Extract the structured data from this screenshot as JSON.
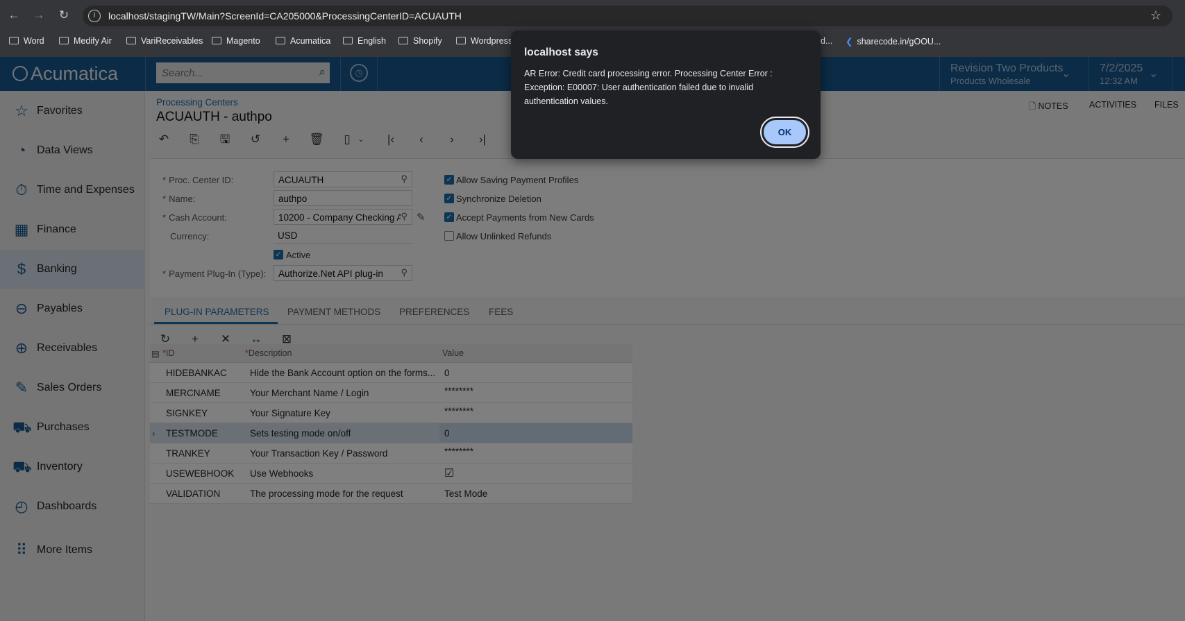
{
  "browser": {
    "url": "localhost/stagingTW/Main?ScreenId=CA205000&ProcessingCenterID=ACUAUTH",
    "bookmarks": [
      "Word",
      "Medify Air",
      "VariReceivables",
      "Magento",
      "Acumatica",
      "English",
      "Shopify",
      "Wordpress",
      "d...",
      "sharecode.in/gOOU..."
    ]
  },
  "header": {
    "logo": "Acumatica",
    "search_placeholder": "Search...",
    "company": "Revision Two Products",
    "branch": "Products Wholesale",
    "date": "7/2/2025",
    "time": "12:32 AM"
  },
  "sidebar": {
    "items": [
      {
        "label": "Favorites"
      },
      {
        "label": "Data Views"
      },
      {
        "label": "Time and Expenses"
      },
      {
        "label": "Finance"
      },
      {
        "label": "Banking"
      },
      {
        "label": "Payables"
      },
      {
        "label": "Receivables"
      },
      {
        "label": "Sales Orders"
      },
      {
        "label": "Purchases"
      },
      {
        "label": "Inventory"
      },
      {
        "label": "Dashboards"
      },
      {
        "label": "More Items"
      }
    ]
  },
  "page": {
    "breadcrumb": "Processing Centers",
    "title": "ACUAUTH - authpo",
    "links": {
      "notes": "NOTES",
      "activities": "ACTIVITIES",
      "files": "FILES"
    }
  },
  "form": {
    "proc_center_id_label": "Proc. Center ID:",
    "proc_center_id": "ACUAUTH",
    "name_label": "Name:",
    "name": "authpo",
    "cash_account_label": "Cash Account:",
    "cash_account": "10200 - Company Checking A",
    "currency_label": "Currency:",
    "currency": "USD",
    "active_label": "Active",
    "plugin_label": "Payment Plug-In (Type):",
    "plugin": "Authorize.Net API plug-in",
    "checks": [
      {
        "label": "Allow Saving Payment Profiles",
        "checked": true
      },
      {
        "label": "Synchronize Deletion",
        "checked": true
      },
      {
        "label": "Accept Payments from New Cards",
        "checked": true
      },
      {
        "label": "Allow Unlinked Refunds",
        "checked": false
      }
    ]
  },
  "tabs": [
    "PLUG-IN PARAMETERS",
    "PAYMENT METHODS",
    "PREFERENCES",
    "FEES"
  ],
  "grid": {
    "columns": [
      "ID",
      "Description",
      "Value"
    ],
    "rows": [
      {
        "id": "HIDEBANKAC",
        "desc": "Hide the Bank Account option on the forms...",
        "value": "0"
      },
      {
        "id": "MERCNAME",
        "desc": "Your Merchant Name / Login",
        "value": "********"
      },
      {
        "id": "SIGNKEY",
        "desc": "Your Signature Key",
        "value": "********"
      },
      {
        "id": "TESTMODE",
        "desc": "Sets testing mode on/off",
        "value": "0"
      },
      {
        "id": "TRANKEY",
        "desc": "Your Transaction Key / Password",
        "value": "********"
      },
      {
        "id": "USEWEBHOOK",
        "desc": "Use Webhooks",
        "value": "☑"
      },
      {
        "id": "VALIDATION",
        "desc": "The processing mode for the request",
        "value": "Test Mode"
      }
    ]
  },
  "dialog": {
    "title": "localhost says",
    "message": "AR Error: Credit card processing error. Processing Center Error : Exception: E00007: User authentication failed due to invalid authentication values.",
    "ok": "OK"
  }
}
